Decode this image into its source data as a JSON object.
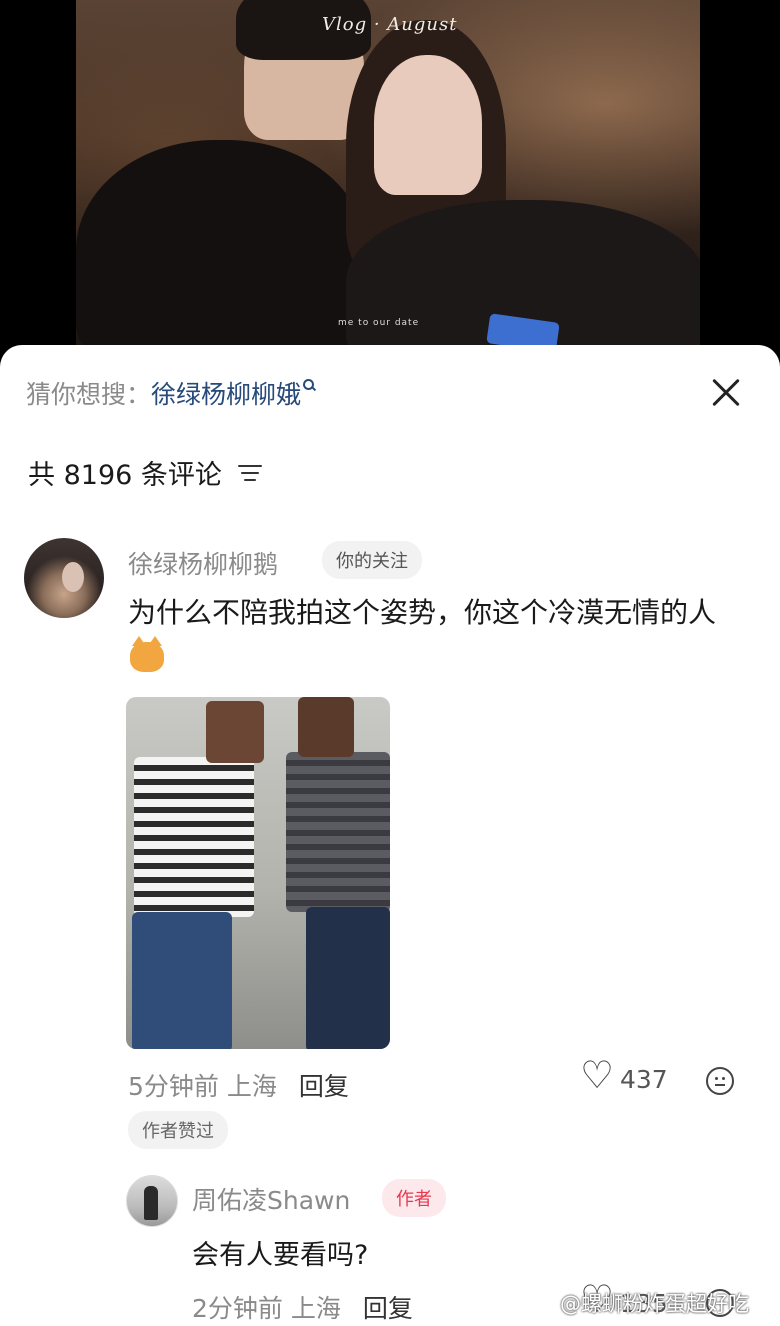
{
  "video": {
    "title_overlay": "Vlog · August",
    "caption": "me to our date"
  },
  "search_suggestion": {
    "prefix": "猜你想搜：",
    "term": "徐绿杨柳柳娥"
  },
  "comments_header": {
    "count_text": "共 8196 条评论"
  },
  "comments": [
    {
      "user": "徐绿杨柳柳鹅",
      "tag": "你的关注",
      "text": "为什么不陪我拍这个姿势，你这个冷漠无情的人",
      "time": "5分钟前",
      "location": "上海",
      "reply_label": "回复",
      "likes": "437",
      "author_liked_tag": "作者赞过"
    }
  ],
  "reply": {
    "user": "周佑凌Shawn",
    "tag": "作者",
    "text": "会有人要看吗?",
    "time": "2分钟前",
    "location": "上海",
    "reply_label": "回复",
    "likes": "135"
  },
  "watermark": "@螺蛳粉炸蛋超好吃",
  "colors": {
    "search_term": "#274a7a",
    "author_tag_bg": "#fde8ec",
    "author_tag_text": "#e8384f",
    "muted_text": "#8a8a8a"
  }
}
